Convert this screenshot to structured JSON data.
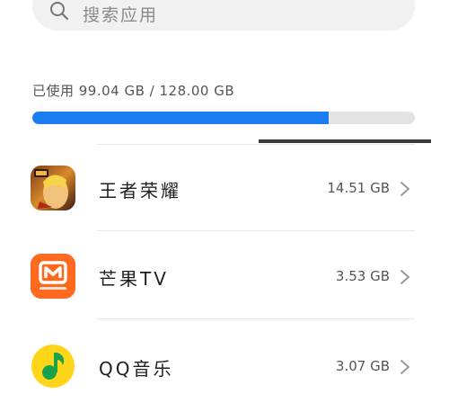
{
  "search": {
    "placeholder": "搜索应用",
    "icon": "search-icon"
  },
  "storage": {
    "text": "已使用 99.04 GB / 128.00 GB",
    "used_gb": 99.04,
    "total_gb": 128.0,
    "used_fraction": 0.7738,
    "bar_color": "#1a7cf0"
  },
  "apps": [
    {
      "name": "王者荣耀",
      "size": "14.51 GB",
      "icon": "honor-of-kings-icon"
    },
    {
      "name": "芒果TV",
      "size": "3.53 GB",
      "icon": "mango-tv-icon"
    },
    {
      "name": "QQ音乐",
      "size": "3.07 GB",
      "icon": "qq-music-icon"
    }
  ]
}
